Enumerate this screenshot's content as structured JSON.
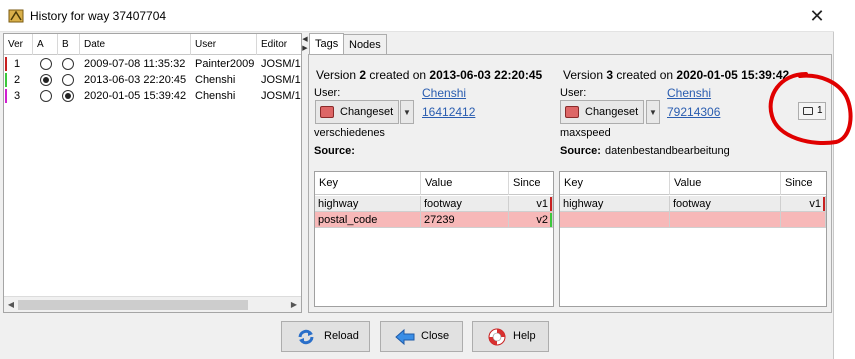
{
  "window": {
    "title": "History for way 37407704",
    "close_glyph": "✕"
  },
  "history": {
    "columns": [
      "Ver",
      "A",
      "B",
      "Date",
      "User",
      "Editor"
    ],
    "rows": [
      {
        "ver": "1",
        "date": "2009-07-08 11:35:32",
        "user": "Painter2009",
        "editor": "JOSM/1.",
        "a": false,
        "b": false,
        "color": "#c82020"
      },
      {
        "ver": "2",
        "date": "2013-06-03 22:20:45",
        "user": "Chenshi",
        "editor": "JOSM/1.",
        "a": true,
        "b": false,
        "color": "#3cc83c"
      },
      {
        "ver": "3",
        "date": "2020-01-05 15:39:42",
        "user": "Chenshi",
        "editor": "JOSM/1.",
        "a": false,
        "b": true,
        "color": "#d020d0"
      }
    ]
  },
  "tabs": [
    "Tags",
    "Nodes"
  ],
  "left_version": {
    "prefix": "Version ",
    "number": "2",
    "mid": " created on ",
    "date": "2013-06-03 22:20:45",
    "user_label": "User:",
    "user": "Chenshi",
    "changeset_label": "Changeset",
    "changeset_id": "16412412",
    "comment": "verschiedenes",
    "source_label": "Source:",
    "source": ""
  },
  "right_version": {
    "prefix": "Version ",
    "number": "3",
    "mid": " created on ",
    "date": "2020-01-05 15:39:42",
    "user_label": "User:",
    "user": "Chenshi",
    "changeset_label": "Changeset",
    "changeset_id": "79214306",
    "comment": "maxspeed",
    "source_label": "Source:",
    "source": "datenbestandbearbeitung",
    "comment_count": "1"
  },
  "tag_table": {
    "columns": [
      "Key",
      "Value",
      "Since"
    ],
    "left_rows": [
      {
        "key": "highway",
        "value": "footway",
        "since": "v1",
        "bg": "#ececec",
        "mark": "#c82020"
      },
      {
        "key": "postal_code",
        "value": "27239",
        "since": "v2",
        "bg": "#f7b8b8",
        "mark": "#3cc83c"
      }
    ],
    "right_rows": [
      {
        "key": "highway",
        "value": "footway",
        "since": "v1",
        "bg": "#ececec",
        "mark": "#c82020"
      },
      {
        "key": "",
        "value": "",
        "since": "",
        "bg": "#f7b8b8",
        "mark": ""
      }
    ]
  },
  "buttons": {
    "reload": "Reload",
    "close": "Close",
    "help": "Help"
  },
  "colors": {
    "link": "#2a5db0",
    "removed_row": "#f7b8b8",
    "annotation": "#e00000"
  }
}
